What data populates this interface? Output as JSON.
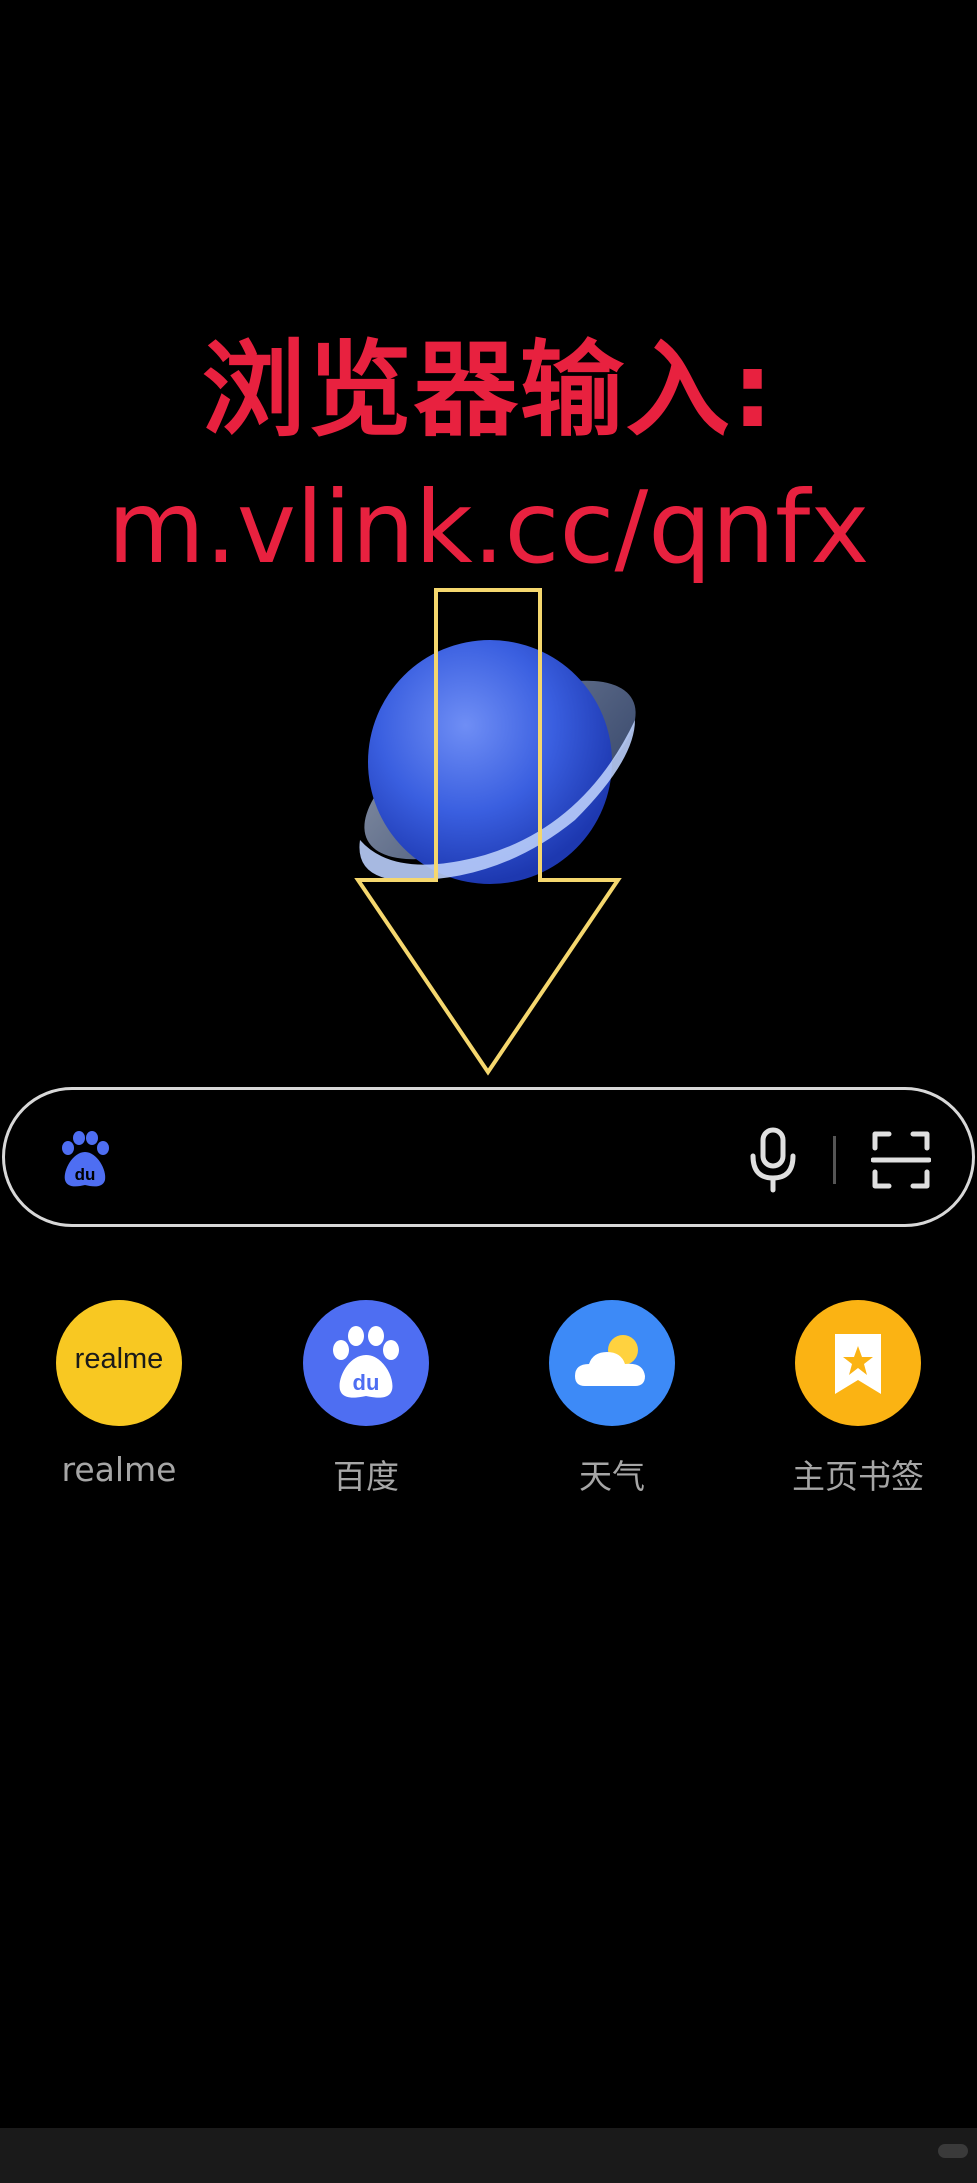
{
  "overlay": {
    "title_line1": "浏览器输入:",
    "title_line2": "m.vlink.cc/qnfx",
    "title_color": "#e8213f",
    "arrow_color": "#f5d76e"
  },
  "app": {
    "logo_icon": "planet-icon"
  },
  "search": {
    "engine_icon": "baidu-paw-icon",
    "value": "",
    "placeholder": "",
    "mic_icon": "microphone-icon",
    "scan_icon": "scan-icon"
  },
  "shortcuts": [
    {
      "label": "realme",
      "icon": "realme-logo-icon",
      "icon_text": "realme",
      "color": "#f8c822"
    },
    {
      "label": "百度",
      "icon": "baidu-paw-icon",
      "color": "#4e6ef2"
    },
    {
      "label": "天气",
      "icon": "weather-cloud-sun-icon",
      "color": "#3d8af7"
    },
    {
      "label": "主页书签",
      "icon": "bookmark-star-icon",
      "color": "#fbb313"
    }
  ]
}
